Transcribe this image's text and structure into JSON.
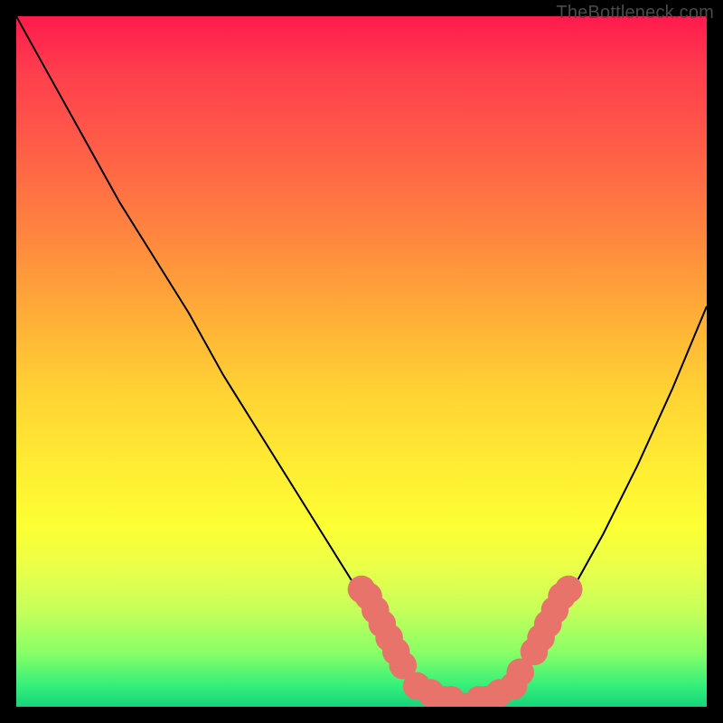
{
  "watermark": "TheBottleneck.com",
  "chart_data": {
    "type": "line",
    "title": "",
    "xlabel": "",
    "ylabel": "",
    "xlim": [
      0,
      100
    ],
    "ylim": [
      0,
      100
    ],
    "grid": false,
    "legend_position": "none",
    "background_gradient": {
      "top_color": "#ff1a4d",
      "bottom_color": "#17d47a",
      "description": "gradient from red (top, bottleneck) to green (bottom, optimal)"
    },
    "series": [
      {
        "name": "bottleneck-curve",
        "color": "#000000",
        "x": [
          0,
          5,
          10,
          15,
          20,
          25,
          30,
          35,
          40,
          45,
          50,
          55,
          57,
          60,
          63,
          65,
          68,
          70,
          75,
          80,
          85,
          90,
          95,
          100
        ],
        "y": [
          100,
          91,
          82,
          73,
          65,
          57,
          48,
          40,
          32,
          24,
          16,
          8,
          5,
          2,
          1,
          0,
          1,
          3,
          8,
          16,
          25,
          35,
          46,
          58
        ]
      }
    ],
    "markers": [
      {
        "name": "fit-cluster",
        "color": "#e8736b",
        "radius": 2.0,
        "points": [
          {
            "x": 50,
            "y": 17
          },
          {
            "x": 51,
            "y": 16
          },
          {
            "x": 52,
            "y": 14
          },
          {
            "x": 53,
            "y": 12
          },
          {
            "x": 54,
            "y": 10
          },
          {
            "x": 55,
            "y": 8
          },
          {
            "x": 56,
            "y": 6
          },
          {
            "x": 58,
            "y": 3
          },
          {
            "x": 60,
            "y": 2
          },
          {
            "x": 62,
            "y": 1
          },
          {
            "x": 63,
            "y": 1
          },
          {
            "x": 65,
            "y": 0
          },
          {
            "x": 67,
            "y": 1
          },
          {
            "x": 68,
            "y": 1
          },
          {
            "x": 70,
            "y": 2
          },
          {
            "x": 72,
            "y": 3
          },
          {
            "x": 73,
            "y": 5
          },
          {
            "x": 75,
            "y": 8
          },
          {
            "x": 76,
            "y": 10
          },
          {
            "x": 77,
            "y": 12
          },
          {
            "x": 78,
            "y": 14
          },
          {
            "x": 79,
            "y": 16
          },
          {
            "x": 80,
            "y": 17
          }
        ]
      }
    ]
  }
}
